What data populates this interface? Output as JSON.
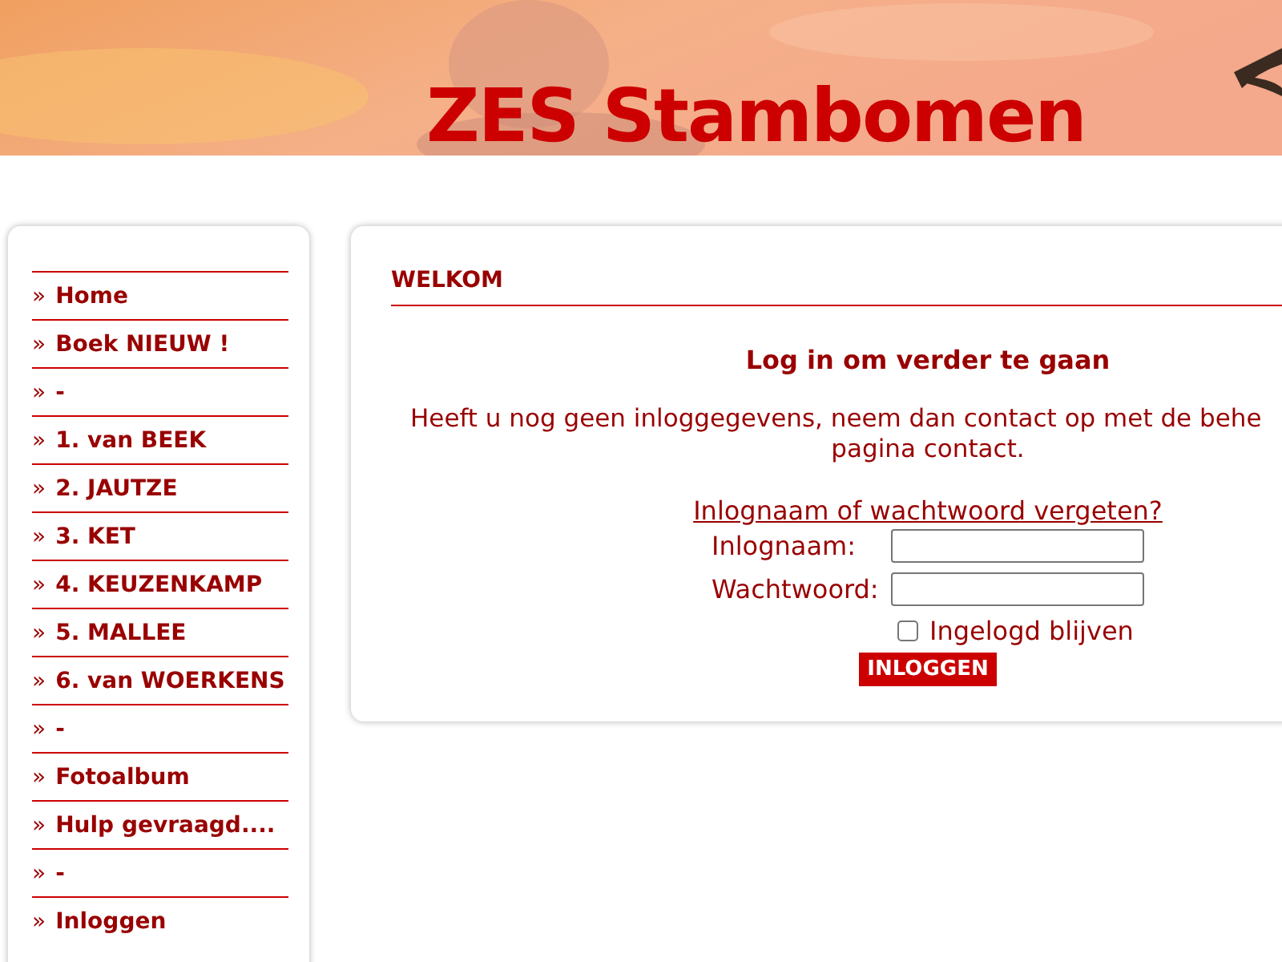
{
  "header": {
    "title": "ZES Stambomen"
  },
  "sidebar": {
    "items": [
      {
        "bullet": "»",
        "label": "Home"
      },
      {
        "bullet": "»",
        "label": "Boek NIEUW !"
      },
      {
        "bullet": "»",
        "label": "-"
      },
      {
        "bullet": "»",
        "label": "1. van BEEK"
      },
      {
        "bullet": "»",
        "label": "2. JAUTZE"
      },
      {
        "bullet": "»",
        "label": "3. KET"
      },
      {
        "bullet": "»",
        "label": "4. KEUZENKAMP"
      },
      {
        "bullet": "»",
        "label": "5. MALLEE"
      },
      {
        "bullet": "»",
        "label": "6. van WOERKENS"
      },
      {
        "bullet": "»",
        "label": "-"
      },
      {
        "bullet": "»",
        "label": "Fotoalbum"
      },
      {
        "bullet": "»",
        "label": "Hulp gevraagd...."
      },
      {
        "bullet": "»",
        "label": "-"
      },
      {
        "bullet": "»",
        "label": "Inloggen"
      }
    ]
  },
  "content": {
    "heading": "WELKOM",
    "title": "Log in om verder te gaan",
    "intro_line_1": "Heeft u nog geen inloggegevens, neem dan contact op met de behe",
    "intro_line_2": "pagina contact.",
    "forgot_link": "Inlognaam of wachtwoord vergeten?",
    "fields": [
      {
        "label": "Inlognaam:"
      },
      {
        "label": "Wachtwoord:"
      }
    ],
    "remember": {
      "label": "Ingelogd blijven",
      "checked": false
    },
    "submit": "INLOGGEN"
  }
}
